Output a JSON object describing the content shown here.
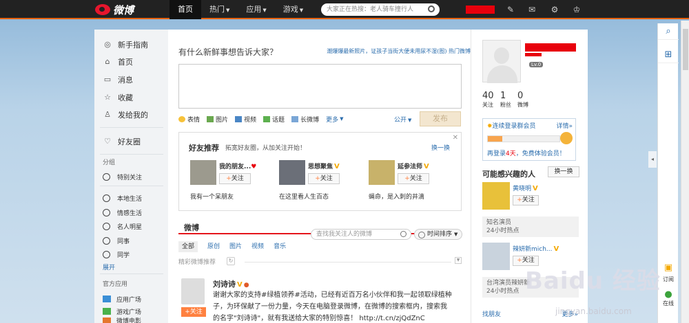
{
  "topbar": {
    "logo_text": "微博",
    "nav": [
      {
        "label": "首页",
        "active": true,
        "dropdown": false
      },
      {
        "label": "热门",
        "active": false,
        "dropdown": true
      },
      {
        "label": "应用",
        "active": false,
        "dropdown": true
      },
      {
        "label": "游戏",
        "active": false,
        "dropdown": true
      }
    ],
    "search_placeholder": "大家正在热搜：老人骑车撞行人",
    "icons": [
      "compose-icon",
      "mail-icon",
      "gear-icon",
      "crown-icon"
    ]
  },
  "left": {
    "items": [
      {
        "label": "新手指南",
        "icon": "compass-icon"
      },
      {
        "label": "首页",
        "icon": "home-icon"
      },
      {
        "label": "消息",
        "icon": "message-icon"
      },
      {
        "label": "收藏",
        "icon": "star-icon"
      },
      {
        "label": "发给我的",
        "icon": "person-icon"
      }
    ],
    "friend_circle": "好友圈",
    "group_header": "分组",
    "special": "特别关注",
    "groups": [
      "本地生活",
      "情感生活",
      "名人明星",
      "同事",
      "同学"
    ],
    "expand": "展开",
    "apps_header": "官方应用",
    "apps": [
      "应用广场",
      "游戏广场",
      "微博电影"
    ]
  },
  "composer": {
    "prompt": "有什么新鲜事想告诉大家？",
    "links": "潮爆爆最新照片，证孩子当街大便未用尿不湿(图)  热门微博",
    "tools": [
      {
        "label": "表情",
        "icon": "emoji-icon"
      },
      {
        "label": "图片",
        "icon": "image-icon"
      },
      {
        "label": "视频",
        "icon": "video-icon"
      },
      {
        "label": "话题",
        "icon": "topic-icon"
      },
      {
        "label": "长微博",
        "icon": "long-post-icon"
      },
      {
        "label": "更多",
        "icon": "more-icon"
      }
    ],
    "visibility": "公开",
    "publish": "发布"
  },
  "recommend": {
    "title": "好友推荐",
    "subtitle": "拓宽好友圈，从加关注开始！",
    "swap": "换一换",
    "follow_label": "关注",
    "cards": [
      {
        "name": "我的朋友...",
        "desc": "我有一个呆朋友"
      },
      {
        "name": "思想聚焦",
        "desc": "在这里看人生百态"
      },
      {
        "name": "延参法师",
        "desc": "蝇命，是入刺的井滴"
      }
    ]
  },
  "feed": {
    "title": "微博",
    "search_placeholder": "查找我关注人的微博",
    "sort": "时间排序",
    "tabs": [
      "全部",
      "原创",
      "图片",
      "视频",
      "音乐"
    ],
    "selected_label": "精彩微博推荐",
    "post": {
      "name": "刘诗诗",
      "follow": "+关注",
      "lines": [
        "谢谢大家的支持#绿植领养#活动，已经有近百万名小伙伴和我一起领取绿植种",
        "子，为环保献了一份力量，今天在电脑登录微博，在微博的搜索框内，搜索我",
        "的名字\"刘诗诗\"，就有我送给大家的特别惊喜！ http://t.cn/zjQdZnC"
      ]
    }
  },
  "profile": {
    "level": "Lv.0",
    "stats": [
      {
        "num": "40",
        "label": "关注"
      },
      {
        "num": "1",
        "label": "粉丝"
      },
      {
        "num": "0",
        "label": "微博"
      }
    ]
  },
  "vip": {
    "title": "连续登录群会员",
    "details": "详情»",
    "progress": 0.2,
    "promo_prefix": "再登录",
    "promo_days": "4天",
    "promo_suffix": "，免费体验会员！"
  },
  "interests": {
    "title": "可能感兴趣的人",
    "swap": "换一换",
    "follow_label": "关注",
    "people": [
      {
        "name": "黄晓明",
        "info1": "知名演员",
        "info2": "24小时热点"
      },
      {
        "name": "辣妍新mich...",
        "info1": "台湾演员辣妍新",
        "info2": "24小时热点"
      }
    ],
    "more_left": "找朋友",
    "more_right": "更多»"
  },
  "sidebar": {
    "subscribe": "订阅",
    "online": "在线"
  },
  "colors": {
    "accent": "#e7610e",
    "link": "#2b6dad",
    "follow": "#ff8140"
  }
}
